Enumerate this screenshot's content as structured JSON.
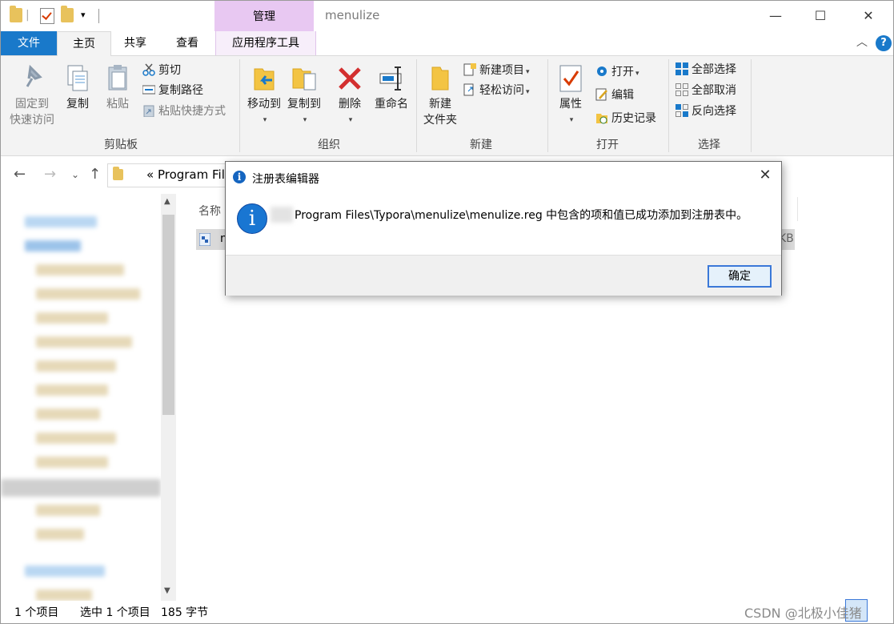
{
  "window": {
    "title": "menulize",
    "manage_tab": "管理",
    "controls": {
      "minimize": "—",
      "maximize": "☐",
      "close": "✕"
    }
  },
  "tabs": {
    "file": "文件",
    "home": "主页",
    "share": "共享",
    "view": "查看",
    "tools": "应用程序工具",
    "help": "?"
  },
  "ribbon": {
    "clipboard": {
      "label": "剪贴板",
      "pin": [
        "固定到",
        "快速访问"
      ],
      "copy": "复制",
      "paste": "粘贴",
      "cut": "剪切",
      "copy_path": "复制路径",
      "paste_shortcut": "粘贴快捷方式"
    },
    "organize": {
      "label": "组织",
      "move_to": "移动到",
      "copy_to": "复制到",
      "delete": "删除",
      "rename": "重命名"
    },
    "new": {
      "label": "新建",
      "new_folder": [
        "新建",
        "文件夹"
      ],
      "new_item": "新建项目",
      "easy_access": "轻松访问"
    },
    "open": {
      "label": "打开",
      "properties": "属性",
      "open": "打开",
      "edit": "编辑",
      "history": "历史记录"
    },
    "select": {
      "label": "选择",
      "select_all": "全部选择",
      "select_none": "全部取消",
      "invert": "反向选择"
    }
  },
  "address": {
    "path": "«  Program Files"
  },
  "filelist": {
    "col_name": "名称",
    "row_first_letter": "n",
    "row_size_tail": "KB"
  },
  "status": {
    "items": "1 个项目",
    "selected": "选中 1 个项目",
    "size": "185 字节"
  },
  "watermark": "CSDN @北极小佳猪",
  "dialog": {
    "title": "注册表编辑器",
    "message": "Program Files\\Typora\\menulize\\menulize.reg 中包含的项和值已成功添加到注册表中。",
    "ok": "确定",
    "close": "✕"
  },
  "colors": {
    "accent": "#1979ca",
    "manage_tab": "#e8c8f2",
    "delete_red": "#d32f2f"
  }
}
